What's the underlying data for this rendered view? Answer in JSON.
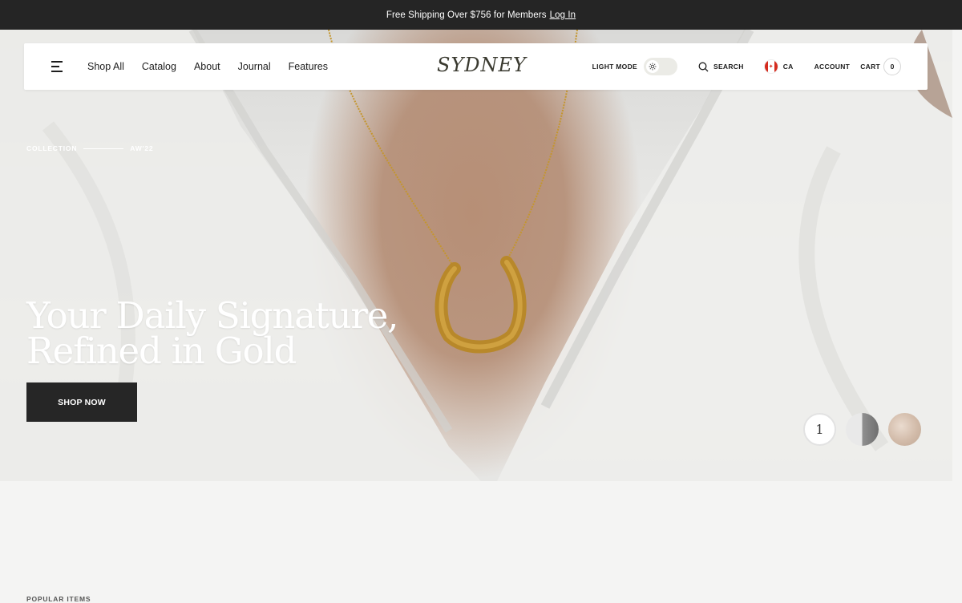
{
  "announcement": {
    "text": "Free Shipping Over $756 for Members",
    "link": "Log In"
  },
  "nav": {
    "links": [
      "Shop All",
      "Catalog",
      "About",
      "Journal",
      "Features"
    ],
    "logo": "SYDNEY",
    "light_mode_label": "LIGHT MODE",
    "search_label": "SEARCH",
    "country_label": "CA",
    "account_label": "ACCOUNT",
    "cart_label": "CART",
    "cart_count": "0"
  },
  "hero": {
    "eyebrow_left": "COLLECTION",
    "eyebrow_right": "AW'22",
    "title_line1": "Your Daily Signature,",
    "title_line2": "Refined in Gold",
    "button_label": "SHOP NOW",
    "active_slide": "1"
  },
  "popular": {
    "label": "POPULAR ITEMS"
  },
  "colors": {
    "accent_dark": "#262626",
    "announcement_bg": "#252525",
    "page_bg": "#f4f4f3",
    "gold": "#c4962e"
  },
  "icons": [
    "hamburger-menu-icon",
    "sun-icon",
    "search-icon",
    "canada-flag-icon"
  ]
}
